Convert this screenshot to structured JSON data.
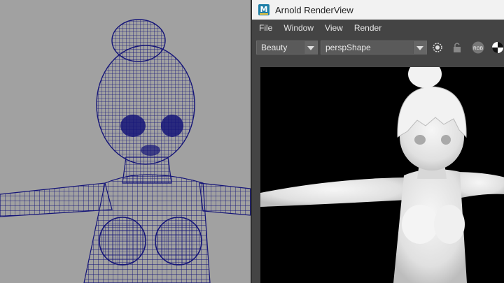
{
  "window": {
    "title": "Arnold RenderView",
    "app_icon": "M"
  },
  "menu": [
    "File",
    "Window",
    "View",
    "Render"
  ],
  "toolbar": {
    "aov": "Beauty",
    "camera": "perspShape",
    "rgb_label": "RGB"
  },
  "icons": [
    "maya-app-icon",
    "refresh-render-icon",
    "lock-icon",
    "rgb-channel-icon",
    "exposure-icon"
  ],
  "colors": {
    "wireframe": "#141478",
    "viewport_bg": "#a1a1a1",
    "render_bg": "#000000",
    "panel": "#444444"
  }
}
